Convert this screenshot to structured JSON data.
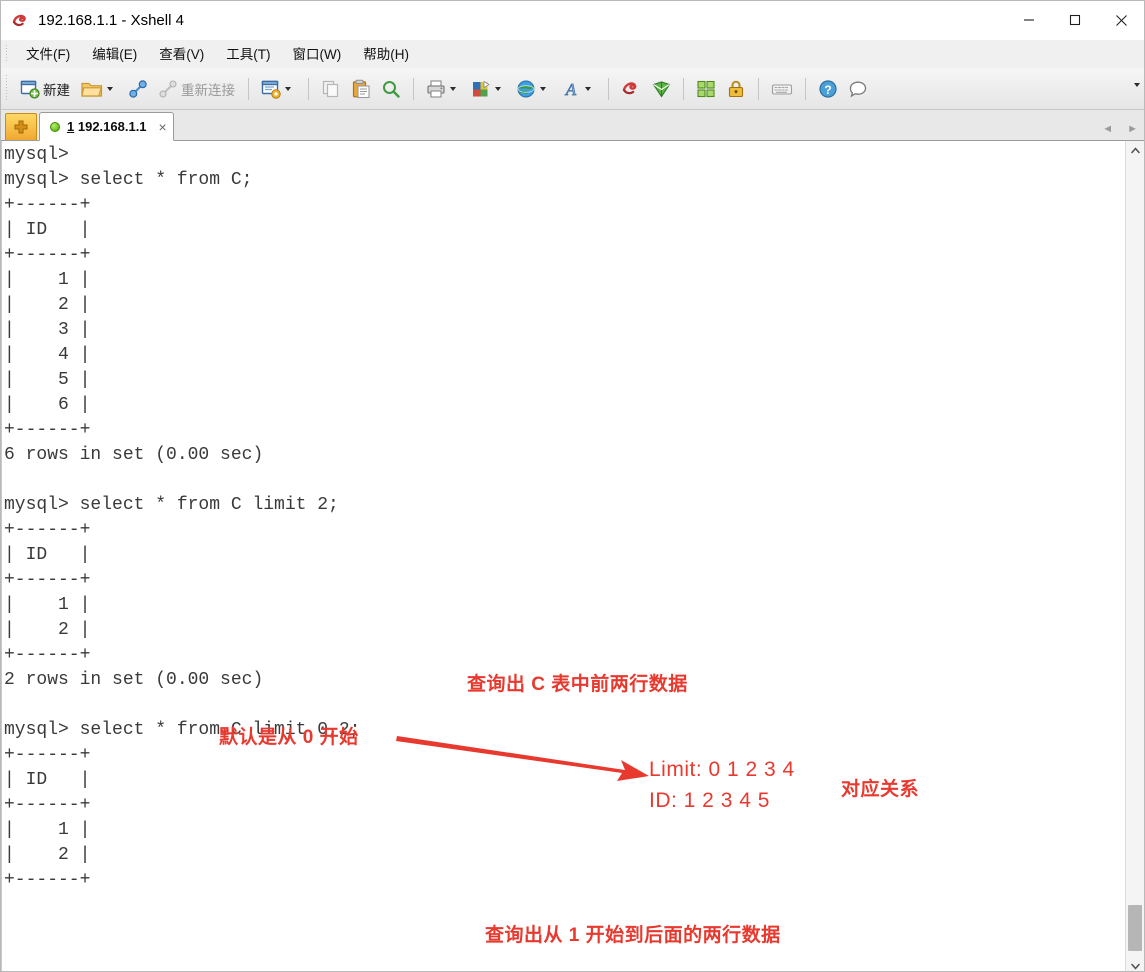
{
  "window": {
    "title": "192.168.1.1 - Xshell 4",
    "controls": {
      "minimize": "minimize-button",
      "maximize": "maximize-button",
      "close": "close-button"
    }
  },
  "menubar": {
    "items": [
      {
        "label": "文件(F)"
      },
      {
        "label": "编辑(E)"
      },
      {
        "label": "查看(V)"
      },
      {
        "label": "工具(T)"
      },
      {
        "label": "窗口(W)"
      },
      {
        "label": "帮助(H)"
      }
    ]
  },
  "toolbar": {
    "new_label": "新建",
    "reconnect_label": "重新连接",
    "overflow_label": "▾"
  },
  "tabbar": {
    "tab": {
      "number": "1",
      "address": "192.168.1.1",
      "close_label": "×"
    },
    "nav_prev": "◄",
    "nav_next": "►"
  },
  "terminal": {
    "lines": [
      "mysql>",
      "mysql> select * from C;",
      "+------+",
      "| ID   |",
      "+------+",
      "|    1 |",
      "|    2 |",
      "|    3 |",
      "|    4 |",
      "|    5 |",
      "|    6 |",
      "+------+",
      "6 rows in set (0.00 sec)",
      "",
      "mysql> select * from C limit 2;",
      "+------+",
      "| ID   |",
      "+------+",
      "|    1 |",
      "|    2 |",
      "+------+",
      "2 rows in set (0.00 sec)",
      "",
      "mysql> select * from C limit 0,2;",
      "+------+",
      "| ID   |",
      "+------+",
      "|    1 |",
      "|    2 |",
      "+------+"
    ]
  },
  "annotations": {
    "note_limit2": "查询出 C 表中前两行数据",
    "note_default_zero": "默认是从 0 开始",
    "map_limit": "Limit:  0 1 2 3 4",
    "map_id": "ID:     1 2 3 4 5",
    "map_relation": "对应关系",
    "note_limit02": "查询出从 1 开始到后面的两行数据",
    "color": "#e8392f"
  }
}
